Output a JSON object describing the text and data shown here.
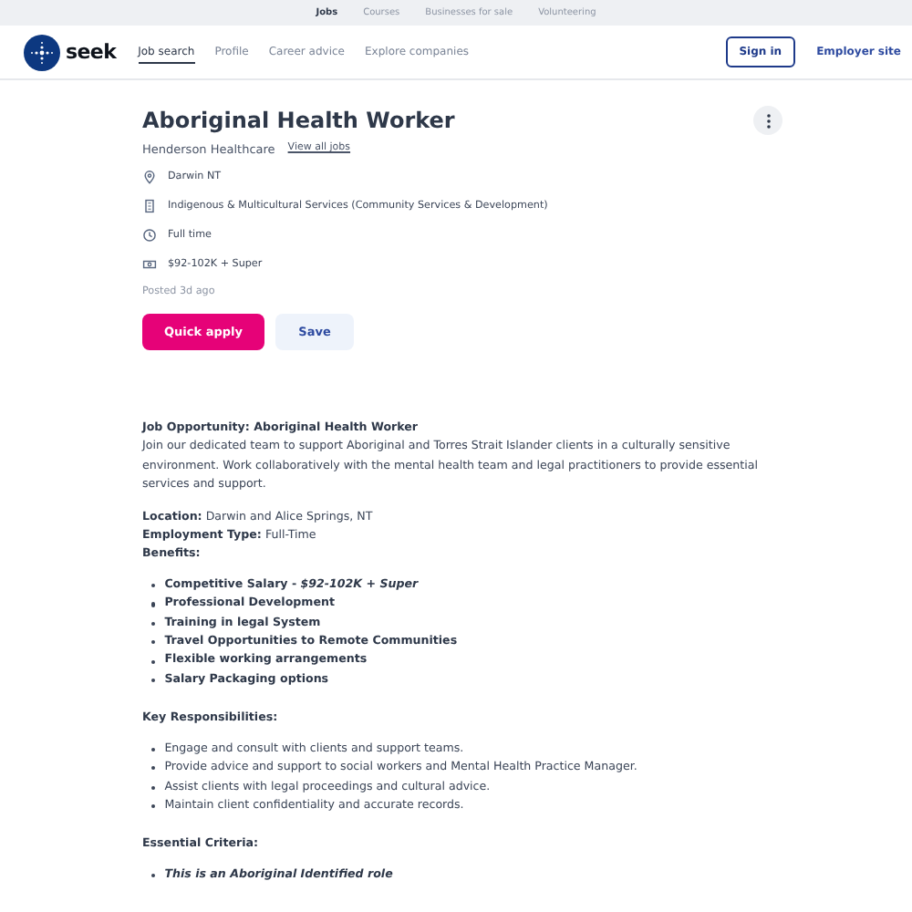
{
  "top_links": [
    {
      "label": "Jobs",
      "selected": true
    },
    {
      "label": "Courses",
      "selected": false
    },
    {
      "label": "Businesses for sale",
      "selected": false
    },
    {
      "label": "Volunteering",
      "selected": false
    }
  ],
  "header": {
    "logo": "seek",
    "nav": [
      {
        "label": "Job search",
        "selected": true
      },
      {
        "label": "Profile",
        "selected": false
      },
      {
        "label": "Career advice",
        "selected": false
      },
      {
        "label": "Explore companies",
        "selected": false
      }
    ],
    "sign_in": "Sign in",
    "employer_site": "Employer site"
  },
  "job": {
    "title": "Aboriginal Health Worker",
    "company": "Henderson Healthcare",
    "view_all": "View all jobs",
    "details": [
      {
        "kind": "location",
        "text": "Darwin NT"
      },
      {
        "kind": "category",
        "text": "Indigenous & Multicultural Services (Community Services & Development)"
      },
      {
        "kind": "worktype",
        "text": "Full time"
      },
      {
        "kind": "salary",
        "text": "$92-102K + Super"
      }
    ],
    "posted": "Posted 3d ago",
    "apply": "Quick apply",
    "save": "Save"
  },
  "description": [
    {
      "kind": "intro",
      "heading": "Job Opportunity: Aboriginal Health Worker",
      "text": "Join our dedicated team to support Aboriginal and Torres Strait Islander clients in a culturally sensitive environment. Work collaboratively with the mental health team and legal practitioners to provide essential services and support."
    },
    {
      "kind": "paragraph",
      "text": "**Location:** Darwin and Alice Springs, NT"
    },
    {
      "kind": "paragraph",
      "text": "**Employment Type:** Full-Time"
    },
    {
      "kind": "heading",
      "text": "Benefits:"
    },
    {
      "kind": "list",
      "bold": true,
      "items": [
        {
          "text": "Competitive Salary - *$92-102K + Super*",
          "italic": false
        },
        {
          "text": "Professional Development",
          "italic": false
        },
        {
          "text": "Training in legal System",
          "italic": false
        },
        {
          "text": "Travel Opportunities to Remote Communities",
          "italic": false
        },
        {
          "text": "Flexible working arrangements",
          "italic": false
        },
        {
          "text": "Salary Packaging options",
          "italic": false
        }
      ]
    },
    {
      "kind": "heading",
      "text": "Key Responsibilities:"
    },
    {
      "kind": "list",
      "bold": false,
      "items": [
        {
          "text": "Engage and consult with clients and support teams.",
          "italic": false
        },
        {
          "text": "Provide advice and support to social workers and Mental Health Practice Manager.",
          "italic": false
        },
        {
          "text": "Assist clients with legal proceedings and cultural advice.",
          "italic": false
        },
        {
          "text": "Maintain client confidentiality and accurate records.",
          "italic": false
        }
      ]
    },
    {
      "kind": "heading",
      "text": "Essential Criteria:"
    },
    {
      "kind": "list",
      "bold": true,
      "items": [
        {
          "text": "This is an Aboriginal Identified role",
          "italic": true
        }
      ]
    }
  ]
}
